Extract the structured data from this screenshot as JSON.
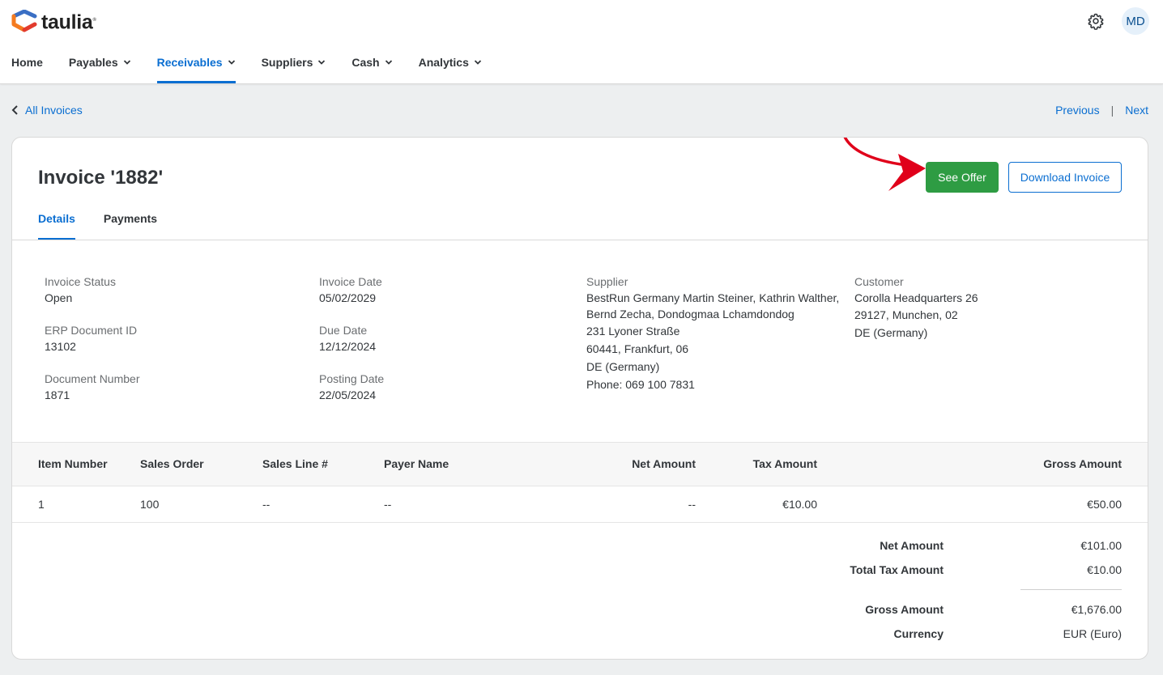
{
  "brand": {
    "name": "taulia",
    "reg": "®"
  },
  "user": {
    "initials": "MD"
  },
  "icons": {
    "settings": "gear-icon",
    "back": "chevron-left-icon",
    "dropdown": "chevron-down-icon"
  },
  "colors": {
    "accent": "#0a6ed1",
    "success": "#2e9c43",
    "annotation": "#e0001a"
  },
  "nav": {
    "items": [
      {
        "label": "Home",
        "dropdown": false
      },
      {
        "label": "Payables",
        "dropdown": true
      },
      {
        "label": "Receivables",
        "dropdown": true,
        "active": true
      },
      {
        "label": "Suppliers",
        "dropdown": true
      },
      {
        "label": "Cash",
        "dropdown": true
      },
      {
        "label": "Analytics",
        "dropdown": true
      }
    ]
  },
  "breadcrumb": {
    "back_label": "All Invoices"
  },
  "pager": {
    "previous": "Previous",
    "separator": "|",
    "next": "Next"
  },
  "invoice": {
    "title": "Invoice '1882'",
    "actions": {
      "see_offer": "See Offer",
      "download": "Download Invoice"
    },
    "tabs": [
      {
        "label": "Details",
        "active": true
      },
      {
        "label": "Payments"
      }
    ],
    "details": {
      "invoice_status": {
        "label": "Invoice Status",
        "value": "Open"
      },
      "erp_document_id": {
        "label": "ERP Document ID",
        "value": "13102"
      },
      "document_number": {
        "label": "Document Number",
        "value": "1871"
      },
      "invoice_date": {
        "label": "Invoice Date",
        "value": "05/02/2029"
      },
      "due_date": {
        "label": "Due Date",
        "value": "12/12/2024"
      },
      "posting_date": {
        "label": "Posting Date",
        "value": "22/05/2024"
      },
      "supplier": {
        "label": "Supplier",
        "lines": [
          "BestRun Germany Martin Steiner, Kathrin Walther,",
          "Bernd Zecha, Dondogmaa Lchamdondog",
          "231 Lyoner Straße",
          "60441, Frankfurt, 06",
          "DE (Germany)",
          "Phone: 069 100 7831"
        ]
      },
      "customer": {
        "label": "Customer",
        "lines": [
          "Corolla Headquarters 26",
          "29127, Munchen, 02",
          "DE (Germany)"
        ]
      }
    },
    "table": {
      "headers": [
        "Item Number",
        "Sales Order",
        "Sales Line #",
        "Payer Name",
        "Net Amount",
        "Tax Amount",
        "Gross Amount"
      ],
      "rows": [
        [
          "1",
          "100",
          "--",
          "--",
          "--",
          "€10.00",
          "€50.00"
        ]
      ]
    },
    "totals": [
      {
        "label": "Net Amount",
        "value": "€101.00"
      },
      {
        "label": "Total Tax Amount",
        "value": "€10.00"
      },
      {
        "label": "Gross Amount",
        "value": "€1,676.00"
      },
      {
        "label": "Currency",
        "value": "EUR (Euro)"
      }
    ]
  }
}
